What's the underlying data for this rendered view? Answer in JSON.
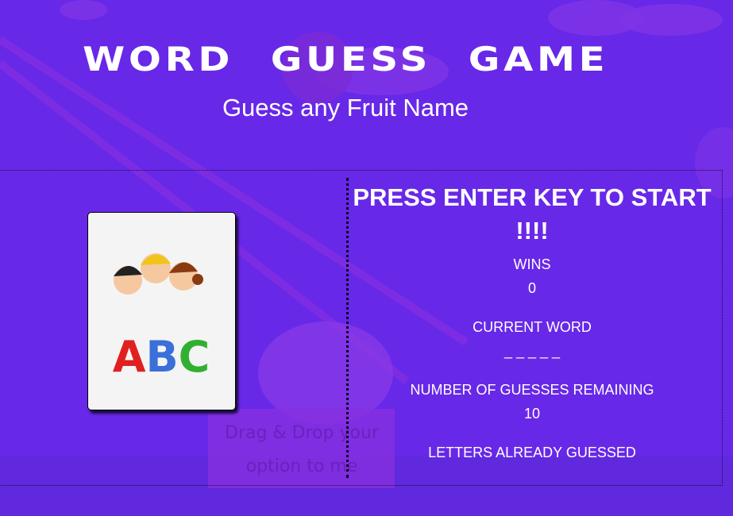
{
  "header": {
    "title": "WORD GUESS GAME",
    "subtitle": "Guess any Fruit Name"
  },
  "image": {
    "icon": "abc-kids-illustration",
    "letters": "ABC"
  },
  "background": {
    "sign_line1": "Drag & Drop your",
    "sign_line2": "option to me"
  },
  "game": {
    "prompt": "PRESS ENTER KEY TO START !!!!",
    "wins_label": "WINS",
    "wins_value": "0",
    "current_word_label": "CURRENT WORD",
    "current_word_value": "_ _ _ _ _",
    "guesses_label": "NUMBER OF GUESSES REMAINING",
    "guesses_value": "10",
    "letters_label": "LETTERS ALREADY GUESSED",
    "letters_value": ""
  },
  "colors": {
    "background": "#6828e8",
    "text": "#ffffff"
  }
}
